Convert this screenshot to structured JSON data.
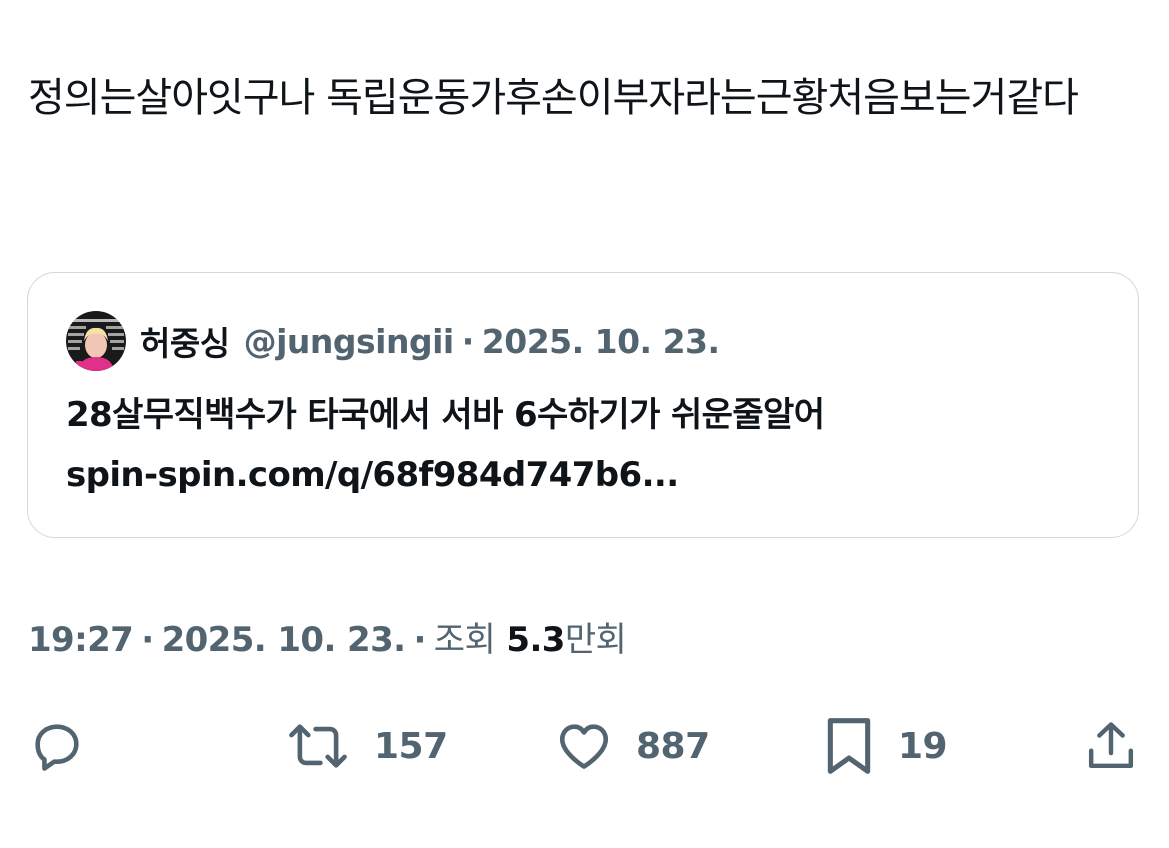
{
  "tweet": {
    "text": "정의는살아잇구나 독립운동가후손이부자라는근황처음보는거같다"
  },
  "quote": {
    "author_name": "허중싱",
    "author_handle": "@jungsingii",
    "separator": "·",
    "date": "2025. 10. 23.",
    "text_line1": "28살무직백수가 타국에서 서바 6수하기가 쉬운줄알어",
    "link": "spin-spin.com/q/68f984d747b6..."
  },
  "meta": {
    "time": "19:27",
    "separator": "·",
    "date": "2025. 10. 23.",
    "views_label": "조회",
    "views_number": "5.3",
    "views_unit": "만회"
  },
  "actions": {
    "reply_icon": "reply-icon",
    "retweet_icon": "retweet-icon",
    "retweet_count": "157",
    "like_icon": "heart-icon",
    "like_count": "887",
    "bookmark_icon": "bookmark-icon",
    "bookmark_count": "19",
    "share_icon": "share-icon"
  },
  "colors": {
    "text_primary": "#0f1419",
    "text_secondary": "#536471",
    "border": "#cfd9de",
    "background": "#ffffff"
  }
}
